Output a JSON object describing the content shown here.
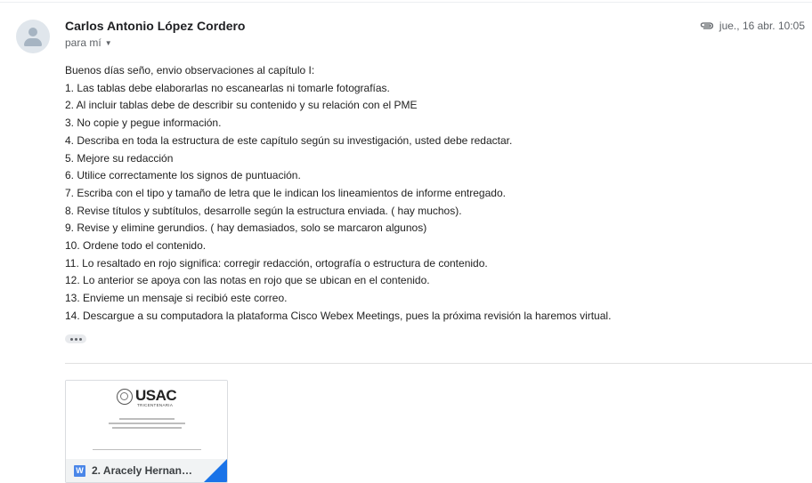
{
  "email": {
    "sender_name": "Carlos Antonio López Cordero",
    "recipient": "para mí",
    "date": "jue., 16 abr. 10:05",
    "body_lines": [
      "Buenos días seño, envio observaciones al capítulo I:",
      "1. Las tablas debe elaborarlas no escanearlas ni tomarle fotografías.",
      "2. Al incluir tablas debe de describir su contenido y su relación con el PME",
      "3. No copie y pegue información.",
      "4. Describa en toda la estructura de este capítulo según su investigación, usted debe redactar.",
      "5. Mejore su redacción",
      "6. Utilice correctamente los signos de puntuación.",
      "7. Escriba con el tipo y tamaño de letra que le indican los lineamientos de informe entregado.",
      "8. Revise títulos y subtítulos, desarrolle según la estructura enviada. ( hay muchos).",
      "9. Revise y elimine gerundios. ( hay demasiados, solo se marcaron algunos)",
      "10. Ordene todo el contenido.",
      "11. Lo resaltado en rojo significa: corregir redacción, ortografía o estructura de contenido.",
      "12. Lo anterior se apoya con las notas en rojo que se ubican en el contenido.",
      "13. Envieme un mensaje si recibió este correo.",
      "14. Descargue a su computadora la plataforma Cisco Webex Meetings, pues la próxima revisión la haremos virtual."
    ]
  },
  "attachment": {
    "file_name": "2. Aracely Hernand...",
    "file_type_letter": "W",
    "preview_logo": "USAC",
    "preview_logo_sub": "TRICENTENARIA"
  },
  "colors": {
    "word_blue": "#4a86e8",
    "corner_blue": "#1a73e8",
    "meta_gray": "#5f6368"
  }
}
